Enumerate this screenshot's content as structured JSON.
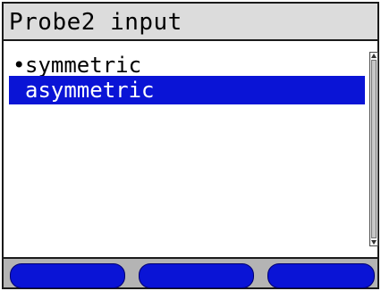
{
  "window": {
    "title": "Probe2 input"
  },
  "list": {
    "items": [
      {
        "label": "symmetric",
        "bullet": "•",
        "selected_marker": true,
        "highlighted": false
      },
      {
        "label": "asymmetric",
        "bullet": "",
        "selected_marker": false,
        "highlighted": true
      }
    ]
  },
  "softkeys": [
    {
      "label": ""
    },
    {
      "label": ""
    },
    {
      "label": ""
    }
  ],
  "colors": {
    "title_bar_bg": "#dcdcdc",
    "highlight": "#0a14d6",
    "softkey": "#0a14d6",
    "softkey_bar_bg": "#b4b4b4"
  }
}
